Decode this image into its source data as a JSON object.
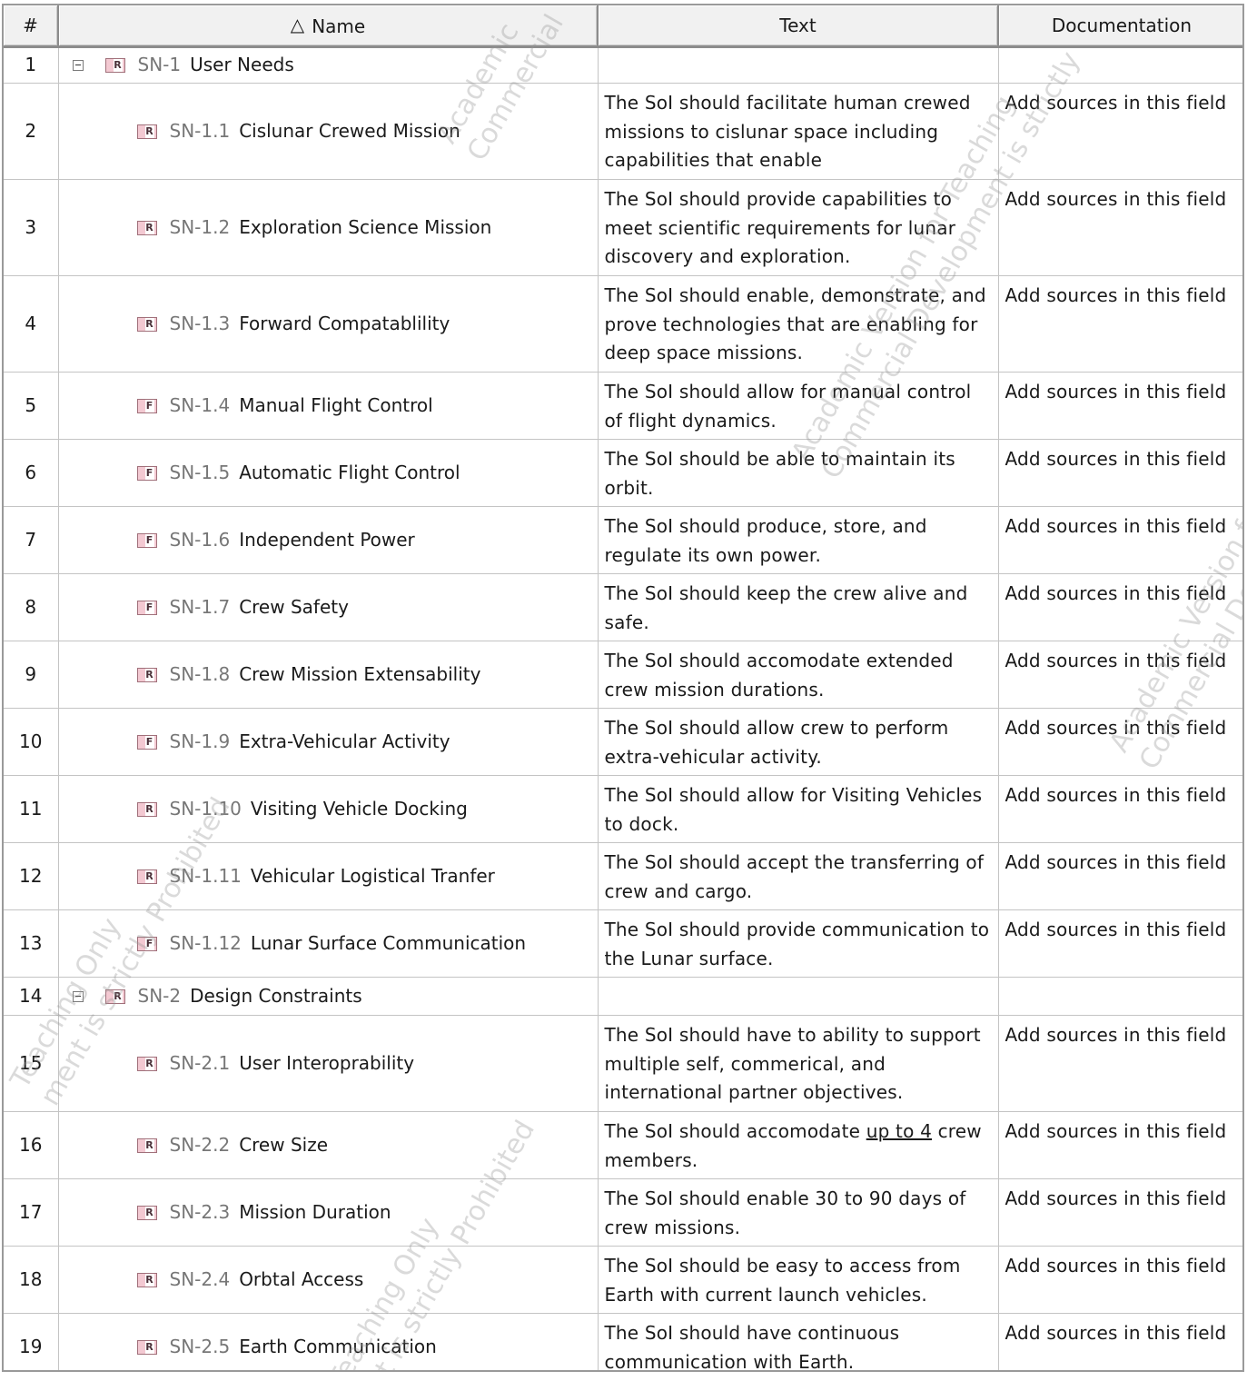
{
  "columns": {
    "num": "#",
    "name": "Name",
    "text": "Text",
    "doc": "Documentation",
    "sort_indicator": "△"
  },
  "rows": [
    {
      "num": "1",
      "kind": "group",
      "icon": "R",
      "id": "SN-1",
      "label": "User Needs",
      "text": "",
      "doc": ""
    },
    {
      "num": "2",
      "kind": "child",
      "icon": "R",
      "id": "SN-1.1",
      "label": "Cislunar Crewed Mission",
      "text": "The SoI should facilitate human crewed missions to cislunar space including capabilities that enable",
      "doc": "Add sources in this field"
    },
    {
      "num": "3",
      "kind": "child",
      "icon": "R",
      "id": "SN-1.2",
      "label": "Exploration Science Mission",
      "text": "The SoI should provide capabilities to meet scientific requirements for lunar discovery and exploration.",
      "doc": "Add sources in this field"
    },
    {
      "num": "4",
      "kind": "child",
      "icon": "R",
      "id": "SN-1.3",
      "label": "Forward Compatablility",
      "text": "The SoI should enable, demonstrate, and prove technologies that are enabling for deep space missions.",
      "doc": "Add sources in this field"
    },
    {
      "num": "5",
      "kind": "child",
      "icon": "F",
      "id": "SN-1.4",
      "label": "Manual Flight Control",
      "text": "The SoI should allow for manual control of flight dynamics.",
      "doc": "Add sources in this field"
    },
    {
      "num": "6",
      "kind": "child",
      "icon": "F",
      "id": "SN-1.5",
      "label": "Automatic Flight Control",
      "text": "The SoI should be able to maintain its orbit.",
      "doc": "Add sources in this field"
    },
    {
      "num": "7",
      "kind": "child",
      "icon": "F",
      "id": "SN-1.6",
      "label": "Independent Power",
      "text": "The SoI should produce, store, and regulate its own power.",
      "doc": "Add sources in this field"
    },
    {
      "num": "8",
      "kind": "child",
      "icon": "F",
      "id": "SN-1.7",
      "label": "Crew Safety",
      "text": "The SoI should keep the crew alive and safe.",
      "doc": "Add sources in this field"
    },
    {
      "num": "9",
      "kind": "child",
      "icon": "R",
      "id": "SN-1.8",
      "label": "Crew Mission Extensability",
      "text": "The SoI should accomodate extended crew mission durations.",
      "doc": "Add sources in this field"
    },
    {
      "num": "10",
      "kind": "child",
      "icon": "F",
      "id": "SN-1.9",
      "label": "Extra-Vehicular Activity",
      "text": "The SoI should allow crew to perform extra-vehicular activity.",
      "doc": "Add sources in this field"
    },
    {
      "num": "11",
      "kind": "child",
      "icon": "R",
      "id": "SN-1.10",
      "label": "Visiting Vehicle Docking",
      "text": "The SoI should allow for Visiting Vehicles to dock.",
      "doc": "Add sources in this field"
    },
    {
      "num": "12",
      "kind": "child",
      "icon": "R",
      "id": "SN-1.11",
      "label": "Vehicular Logistical Tranfer",
      "text": "The SoI should accept the transferring of crew and cargo.",
      "doc": "Add sources in this field"
    },
    {
      "num": "13",
      "kind": "child",
      "icon": "F",
      "id": "SN-1.12",
      "label": "Lunar Surface Communication",
      "text": "The SoI should provide communication to the Lunar surface.",
      "doc": "Add sources in this field"
    },
    {
      "num": "14",
      "kind": "group",
      "icon": "R",
      "id": "SN-2",
      "label": "Design Constraints",
      "text": "",
      "doc": ""
    },
    {
      "num": "15",
      "kind": "child",
      "icon": "R",
      "id": "SN-2.1",
      "label": "User Interoprability",
      "text": "The SoI should have to ability to support multiple self, commerical, and international partner objectives.",
      "doc": "Add sources in this field"
    },
    {
      "num": "16",
      "kind": "child",
      "icon": "R",
      "id": "SN-2.2",
      "label": "Crew Size",
      "text_before": "The SoI should accomodate ",
      "text_underlined": "up to 4",
      "text_after": " crew members.",
      "doc": "Add sources in this field"
    },
    {
      "num": "17",
      "kind": "child",
      "icon": "R",
      "id": "SN-2.3",
      "label": "Mission Duration",
      "text": "The SoI should enable 30 to 90 days of crew missions.",
      "doc": "Add sources in this field"
    },
    {
      "num": "18",
      "kind": "child",
      "icon": "R",
      "id": "SN-2.4",
      "label": "Orbtal Access",
      "text": "The SoI should be easy to access from Earth with current launch vehicles.",
      "doc": "Add sources in this field"
    },
    {
      "num": "19",
      "kind": "child",
      "icon": "R",
      "id": "SN-2.5",
      "label": "Earth Communication",
      "text": "The SoI should have continuous communication with Earth.",
      "doc": "Add sources in this field"
    }
  ]
}
